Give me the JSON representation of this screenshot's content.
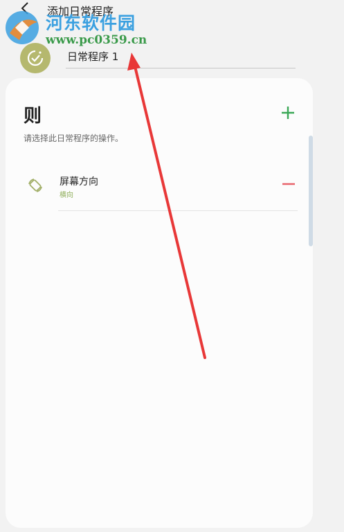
{
  "header": {
    "title": "添加日常程序"
  },
  "watermark": {
    "name": "河东软件园",
    "url": "www.pc0359.cn"
  },
  "routine": {
    "name_value": "日常程序 1"
  },
  "then_section": {
    "title": "则",
    "subtitle": "请选择此日常程序的操作。",
    "actions": [
      {
        "name": "屏幕方向",
        "value": "横向"
      }
    ]
  },
  "colors": {
    "accent_green": "#3aa856",
    "remove_red": "#e8626a",
    "routine_icon": "#b5b86e",
    "action_value": "#8fae5a",
    "annotation_arrow": "#e83838"
  },
  "icons": {
    "back": "back-arrow-icon",
    "routine": "check-circle-icon",
    "add": "plus-icon",
    "action": "screen-rotate-icon",
    "remove": "minus-icon"
  }
}
